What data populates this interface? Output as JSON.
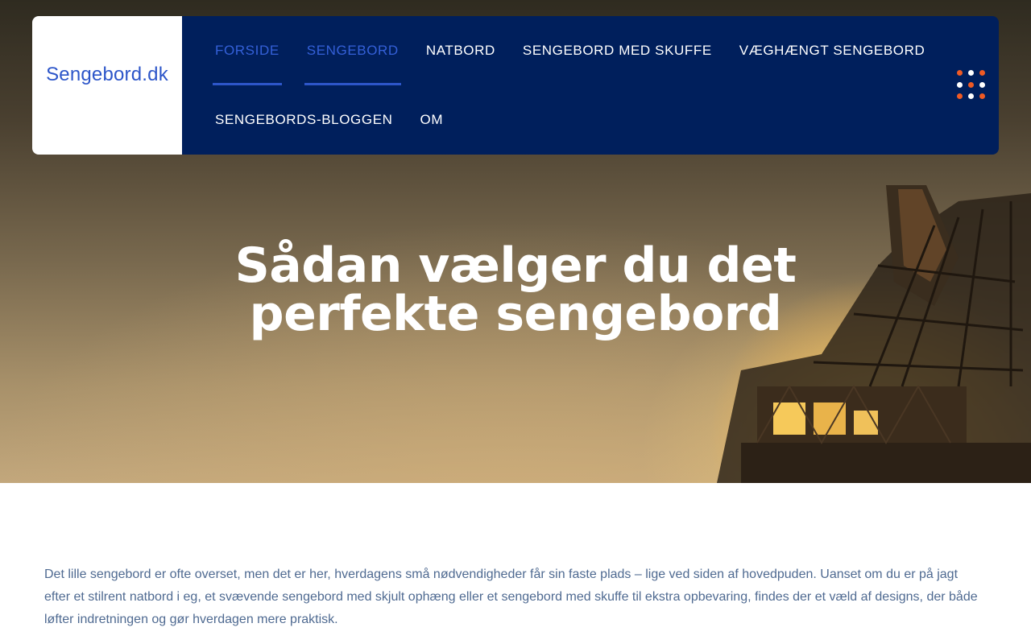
{
  "site": {
    "logo": "Sengebord.dk"
  },
  "nav": {
    "row1": [
      {
        "label": "FORSIDE",
        "active": true
      },
      {
        "label": "SENGEBORD",
        "active": true
      },
      {
        "label": "NATBORD",
        "active": false
      },
      {
        "label": "SENGEBORD MED SKUFFE",
        "active": false
      },
      {
        "label": "VÆGHÆNGT SENGEBORD",
        "active": false
      }
    ],
    "row2": [
      {
        "label": "SENGEBORDS-BLOGGEN",
        "active": false
      },
      {
        "label": "OM",
        "active": false
      }
    ],
    "menu_icon": "grid-dots-icon"
  },
  "hero": {
    "title": "Sådan vælger du det perfekte sengebord",
    "background": "crane-at-dusk-photo"
  },
  "article": {
    "intro": "Det lille sengebord er ofte overset, men det er her, hverdagens små nødvendigheder får sin faste plads – lige ved siden af hovedpuden. Uanset om du er på jagt efter et stilrent natbord i eg, et svævende sengebord med skjult ophæng eller et sengebord med skuffe til ekstra opbevaring, findes der et væld af designs, der både løfter indretningen og gør hverdagen mere praktisk."
  },
  "colors": {
    "nav_bg": "#001f5c",
    "brand_blue": "#2d56c9",
    "accent_orange": "#ef5a24",
    "body_text": "#4f6a91"
  }
}
